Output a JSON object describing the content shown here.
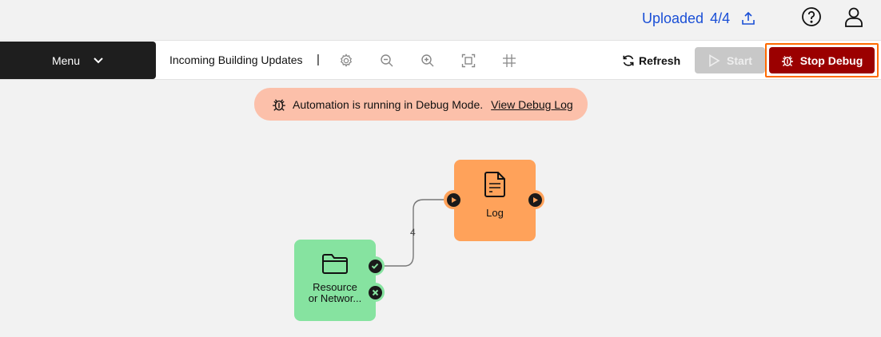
{
  "header": {
    "uploaded_label": "Uploaded",
    "uploaded_count": "4/4",
    "icons": [
      "upload-icon",
      "help-icon",
      "user-icon"
    ]
  },
  "toolbar": {
    "menu_label": "Menu",
    "title": "Incoming Building Updates",
    "title_separator": "|",
    "tools": [
      "settings-icon",
      "zoom-out-icon",
      "zoom-in-icon",
      "fit-screen-icon",
      "grid-icon"
    ],
    "refresh_label": "Refresh",
    "start_label": "Start",
    "stop_debug_label": "Stop Debug"
  },
  "banner": {
    "message": "Automation is running in Debug Mode.",
    "link_text": "View Debug Log",
    "color": "#fcc0aa"
  },
  "canvas": {
    "edge_count": "4",
    "nodes": [
      {
        "id": "log",
        "label": "Log",
        "icon": "document-icon",
        "color": "#ffa25a"
      },
      {
        "id": "resource",
        "label_line1": "Resource",
        "label_line2": "or Networ...",
        "icon": "folder-icon",
        "color": "#86e3a0"
      }
    ]
  },
  "colors": {
    "accent_link": "#1a4fd6",
    "stop_button": "#9b0000",
    "stop_outline": "#ff6a00",
    "menu_bg": "#1e1e1e"
  }
}
